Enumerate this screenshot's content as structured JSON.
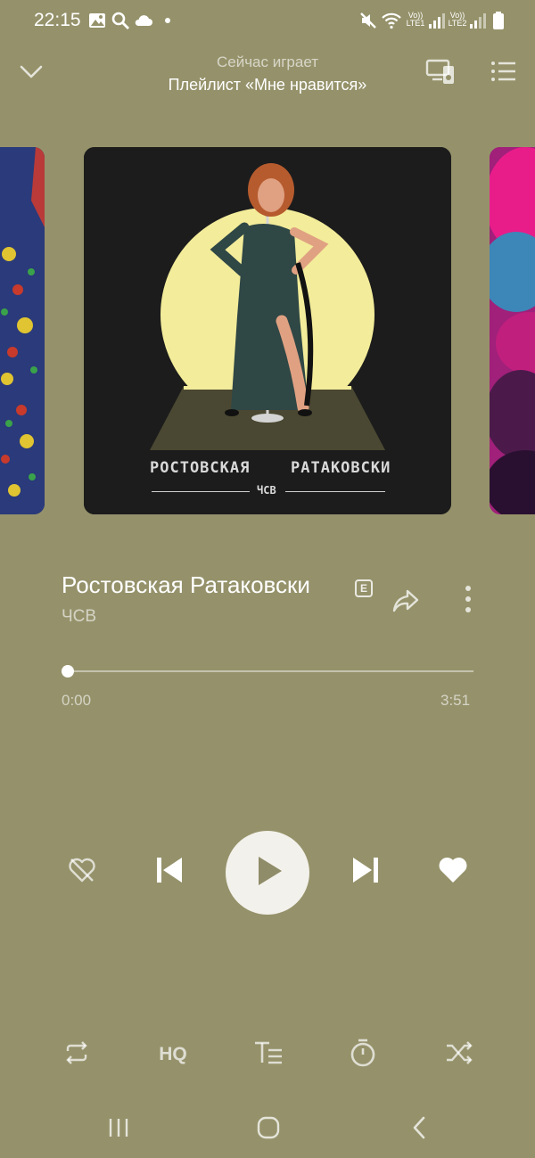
{
  "status_bar": {
    "time": "22:15",
    "sim1_label": "Vo)) LTE1",
    "sim2_label": "Vo)) LTE2",
    "icons": [
      "gallery-icon",
      "search-icon",
      "cloud-icon",
      "dot-icon",
      "mute-icon",
      "wifi-icon",
      "signal-icon",
      "battery-icon"
    ]
  },
  "header": {
    "subtitle": "Сейчас играет",
    "playlist": "Плейлист «Мне нравится»",
    "icons": [
      "chevron-down-icon",
      "cast-devices-icon",
      "queue-list-icon"
    ]
  },
  "cover": {
    "text_left": "РОСТОВСКАЯ",
    "text_right": "РАТАКОВСКИ",
    "artist": "ЧСВ"
  },
  "track": {
    "title": "Ростовская Ратаковски",
    "explicit_badge": "E",
    "artist": "ЧСВ"
  },
  "progress": {
    "position": "0:00",
    "duration": "3:51",
    "fraction": 0.0
  },
  "controls": {
    "icons": [
      "dislike-icon",
      "previous-icon",
      "play-icon",
      "next-icon",
      "like-heart-icon"
    ]
  },
  "bottom_bar": {
    "hq_label": "HQ",
    "icons": [
      "repeat-icon",
      "hq-icon",
      "lyrics-icon",
      "timer-icon",
      "shuffle-icon"
    ]
  },
  "nav_bar": {
    "icons": [
      "recent-apps-icon",
      "home-icon",
      "back-icon"
    ]
  },
  "colors": {
    "background": "#95926b",
    "accent": "#ffffff",
    "cover_sun": "#f3ec9a",
    "dress": "#2f4745"
  }
}
